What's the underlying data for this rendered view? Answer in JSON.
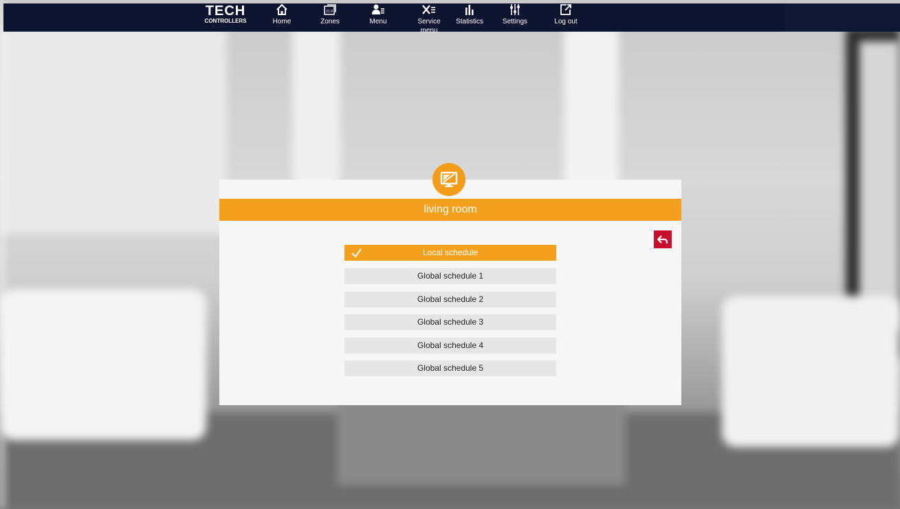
{
  "brand": {
    "name": "TECH",
    "sub": "CONTROLLERS"
  },
  "nav": [
    {
      "label": "Home",
      "icon": "home-icon"
    },
    {
      "label": "Zones",
      "icon": "zones-icon",
      "icon_text": "21.0"
    },
    {
      "label": "Menu",
      "icon": "menu-icon"
    },
    {
      "label": "Service menu",
      "icon": "service-menu-icon"
    },
    {
      "label": "Statistics",
      "icon": "statistics-icon"
    },
    {
      "label": "Settings",
      "icon": "settings-icon"
    },
    {
      "label": "Log out",
      "icon": "log-out-icon"
    }
  ],
  "panel": {
    "title": "living room",
    "icon": "monitor-icon",
    "back_icon": "back-arrow-icon",
    "options": [
      {
        "label": "Local schedule",
        "selected": true
      },
      {
        "label": "Global schedule 1",
        "selected": false
      },
      {
        "label": "Global schedule 2",
        "selected": false
      },
      {
        "label": "Global schedule 3",
        "selected": false
      },
      {
        "label": "Global schedule 4",
        "selected": false
      },
      {
        "label": "Global schedule 5",
        "selected": false
      }
    ]
  },
  "colors": {
    "accent": "#f5a01d",
    "navbar": "#0d1430",
    "back_button": "#c8102e"
  }
}
